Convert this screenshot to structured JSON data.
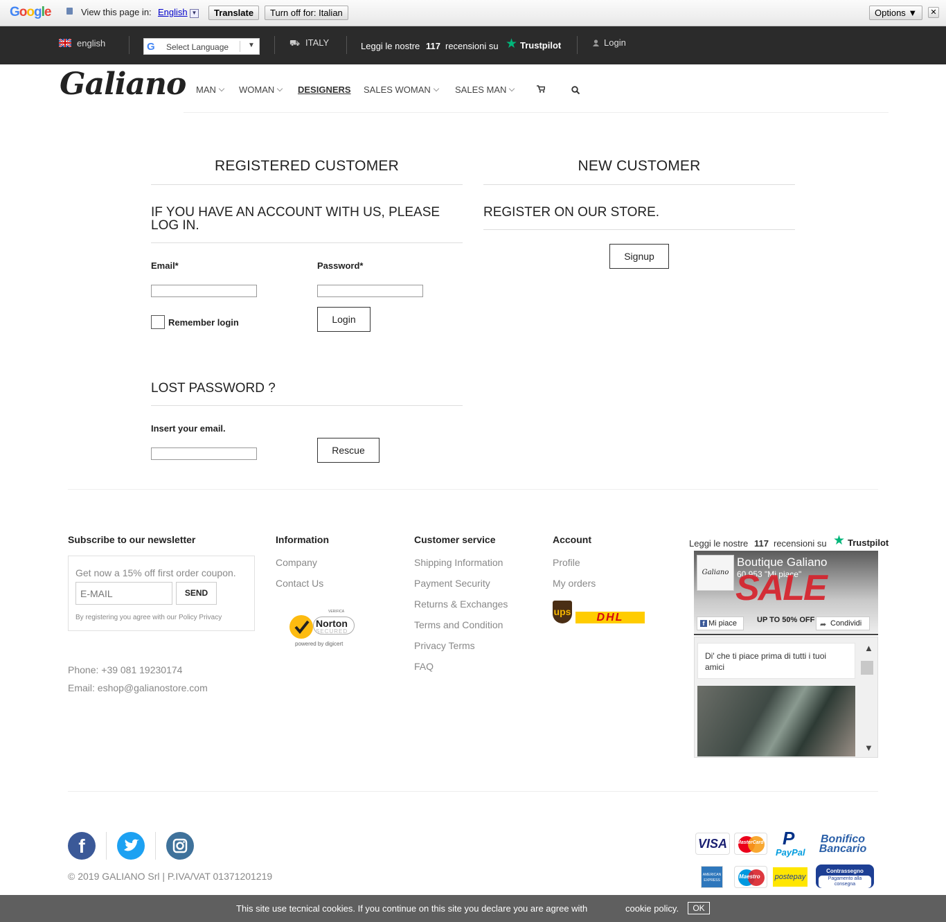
{
  "gtranslate": {
    "logo": "Google",
    "view_label": "View this page in:",
    "language": "English",
    "translate_btn": "Translate",
    "turnoff_btn": "Turn off for: Italian",
    "options_btn": "Options ▼",
    "close": "✕"
  },
  "topbar": {
    "lang": "english",
    "select_language": "Select Language",
    "country": "ITALY",
    "reviews_pre": "Leggi le nostre",
    "reviews_count": "117",
    "reviews_post": "recensioni su",
    "trustpilot": "Trustpilot",
    "login": "Login"
  },
  "logo": "Galiano",
  "nav": {
    "items": [
      "MAN",
      "WOMAN",
      "DESIGNERS",
      "SALES WOMAN",
      "SALES MAN"
    ]
  },
  "registered": {
    "title": "REGISTERED CUSTOMER",
    "subtitle": "IF YOU HAVE AN ACCOUNT WITH US, PLEASE LOG IN.",
    "email_label": "Email*",
    "password_label": "Password*",
    "remember": "Remember login",
    "login_btn": "Login",
    "lost_title": "LOST PASSWORD ?",
    "insert_email": "Insert your email.",
    "rescue_btn": "Rescue"
  },
  "newcustomer": {
    "title": "NEW CUSTOMER",
    "subtitle": "REGISTER ON OUR STORE.",
    "signup_btn": "Signup"
  },
  "footer": {
    "newsletter": {
      "title": "Subscribe to our newsletter",
      "promo": "Get now a 15% off first order coupon.",
      "email_placeholder": "E-MAIL",
      "send_btn": "SEND",
      "disclaimer": "By registering you agree with our Policy Privacy"
    },
    "information": {
      "title": "Information",
      "links": [
        "Company",
        "Contact Us"
      ]
    },
    "customer_service": {
      "title": "Customer service",
      "links": [
        "Shipping Information",
        "Payment Security",
        "Returns & Exchanges",
        "Terms and Condition",
        "Privacy Terms",
        "FAQ"
      ]
    },
    "account": {
      "title": "Account",
      "links": [
        "Profile",
        "My orders"
      ]
    },
    "norton": {
      "verifica": "VERIFICA",
      "name": "Norton",
      "secured": "SECURED",
      "powered": "powered by digicert"
    },
    "shipping": {
      "ups": "ups",
      "dhl": "DHL"
    },
    "trustpilot": {
      "pre": "Leggi le nostre",
      "count": "117",
      "post": "recensioni su",
      "brand": "Trustpilot"
    },
    "facebook": {
      "page": "Boutique Galiano",
      "likes": "60.953 \"Mi piace\"",
      "sale": "SALE",
      "offer": "UP TO 50% OFF",
      "like_btn": "Mi piace",
      "share_btn": "Condividi",
      "friends": "Di' che ti piace prima di tutti i tuoi amici"
    },
    "phone": "Phone: +39 081 19230174",
    "email": "Email: eshop@galianostore.com",
    "copyright": "© 2019 GALIANO Srl | P.IVA/VAT 01371201219",
    "payments": {
      "visa": "VISA",
      "mastercard": "MasterCard",
      "paypal": "PayPal",
      "bonifico1": "Bonifico",
      "bonifico2": "Bancario",
      "amex": "AMERICAN EXPRESS",
      "maestro": "Maestro",
      "postepay": "postepay",
      "contr1": "Contrassegno",
      "contr2": "Pagamento alla consegna"
    }
  },
  "cookie": {
    "text": "This site use tecnical cookies. If you continue on this site you declare you are agree with",
    "link": "cookie policy.",
    "ok": "OK"
  },
  "colors": {
    "trustpilot_green": "#00b67a",
    "facebook_blue": "#3b5998",
    "twitter_blue": "#1da1f2",
    "instagram": "#3f729b"
  }
}
